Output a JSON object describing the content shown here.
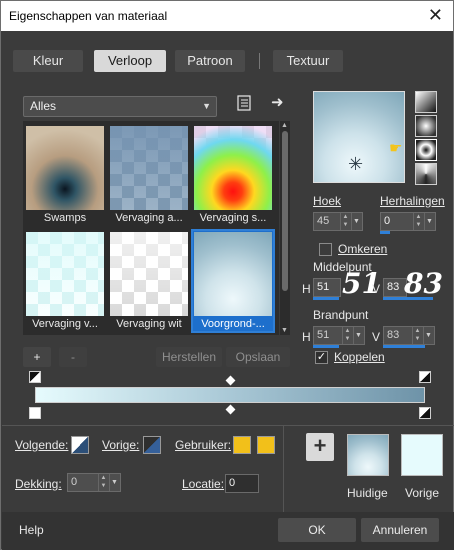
{
  "window": {
    "title": "Eigenschappen van materiaal"
  },
  "tabs": [
    {
      "label": "Kleur",
      "active": false
    },
    {
      "label": "Verloop",
      "active": true
    },
    {
      "label": "Patroon",
      "active": false
    },
    {
      "label": "Textuur",
      "active": false
    }
  ],
  "category_dropdown": {
    "value": "Alles"
  },
  "gallery": {
    "items": [
      {
        "label": "Swamps"
      },
      {
        "label": "Vervaging a..."
      },
      {
        "label": "Vervaging s..."
      },
      {
        "label": "Vervaging v..."
      },
      {
        "label": "Vervaging wit"
      },
      {
        "label": "Voorgrond-...",
        "selected": true
      }
    ]
  },
  "gallery_buttons": {
    "add": "+",
    "remove": "-",
    "reset": "Herstellen",
    "save": "Opslaan"
  },
  "angle": {
    "label": "Hoek",
    "value": "45"
  },
  "repeats": {
    "label": "Herhalingen",
    "value": "0"
  },
  "invert": {
    "label": "Omkeren",
    "checked": false
  },
  "center_point": {
    "label": "Middelpunt",
    "h_label": "H",
    "h_value": "51",
    "v_label": "V",
    "v_value": "83",
    "h_big": "51",
    "v_big": "83"
  },
  "focal_point": {
    "label": "Brandpunt",
    "h_label": "H",
    "h_value": "51",
    "v_label": "V",
    "v_value": "83"
  },
  "link": {
    "label": "Koppelen",
    "checked": true
  },
  "bottom": {
    "next_label": "Volgende:",
    "prev_label": "Vorige:",
    "user_label": "Gebruiker:",
    "opacity_label": "Dekking:",
    "opacity_value": "0",
    "location_label": "Locatie:",
    "location_value": "0"
  },
  "current": {
    "label": "Huidige"
  },
  "previous": {
    "label": "Vorige"
  },
  "footer": {
    "help": "Help",
    "ok": "OK",
    "cancel": "Annuleren"
  },
  "colors": {
    "accent": "#2f80d8",
    "user_swatch": "#f2c01a",
    "gradient_start": "#e6fbfd",
    "gradient_end": "#6e93a8"
  }
}
